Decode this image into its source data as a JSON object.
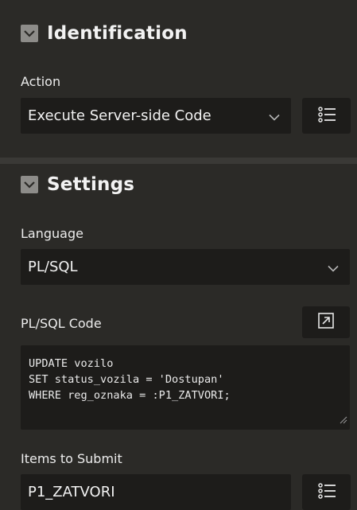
{
  "identification": {
    "title": "Identification",
    "action_label": "Action",
    "action_value": "Execute Server-side Code"
  },
  "settings": {
    "title": "Settings",
    "language_label": "Language",
    "language_value": "PL/SQL",
    "code_label": "PL/SQL Code",
    "code_lines": [
      "UPDATE vozilo",
      "SET status_vozila = 'Dostupan'",
      "WHERE reg_oznaka = :P1_ZATVORI;"
    ],
    "items_label": "Items to Submit",
    "items_value": "P1_ZATVORI"
  },
  "icons": {
    "collapse": "chevron-down-icon",
    "list": "list-icon",
    "expand": "expand-editor-icon"
  },
  "colors": {
    "background": "#2b2a27",
    "field_background": "#1d1c1a",
    "text": "#e6e6e6"
  }
}
